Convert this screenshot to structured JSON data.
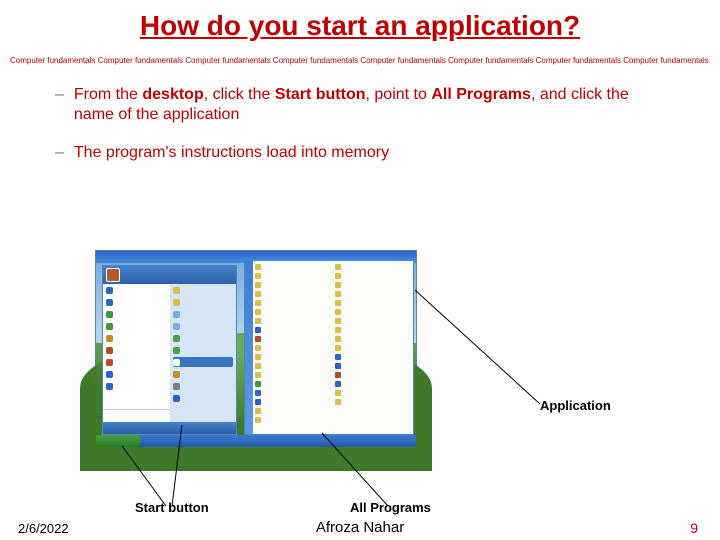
{
  "title": "How do you start an application?",
  "band_unit": "Computer fundamentals ",
  "band_repeat_count": 8,
  "bullets": [
    {
      "prefix": "From the ",
      "b1": "desktop",
      "mid1": ", click the ",
      "b2": "Start button",
      "mid2": ", point to ",
      "b3": "All Programs",
      "mid3": ", and click the name of the application"
    },
    {
      "plain": "The program's instructions load into memory"
    }
  ],
  "callouts": {
    "application": "Application",
    "start_button": "Start button",
    "all_programs": "All Programs"
  },
  "footer": {
    "date": "2/6/2022",
    "author": "Afroza Nahar",
    "page": "9"
  }
}
